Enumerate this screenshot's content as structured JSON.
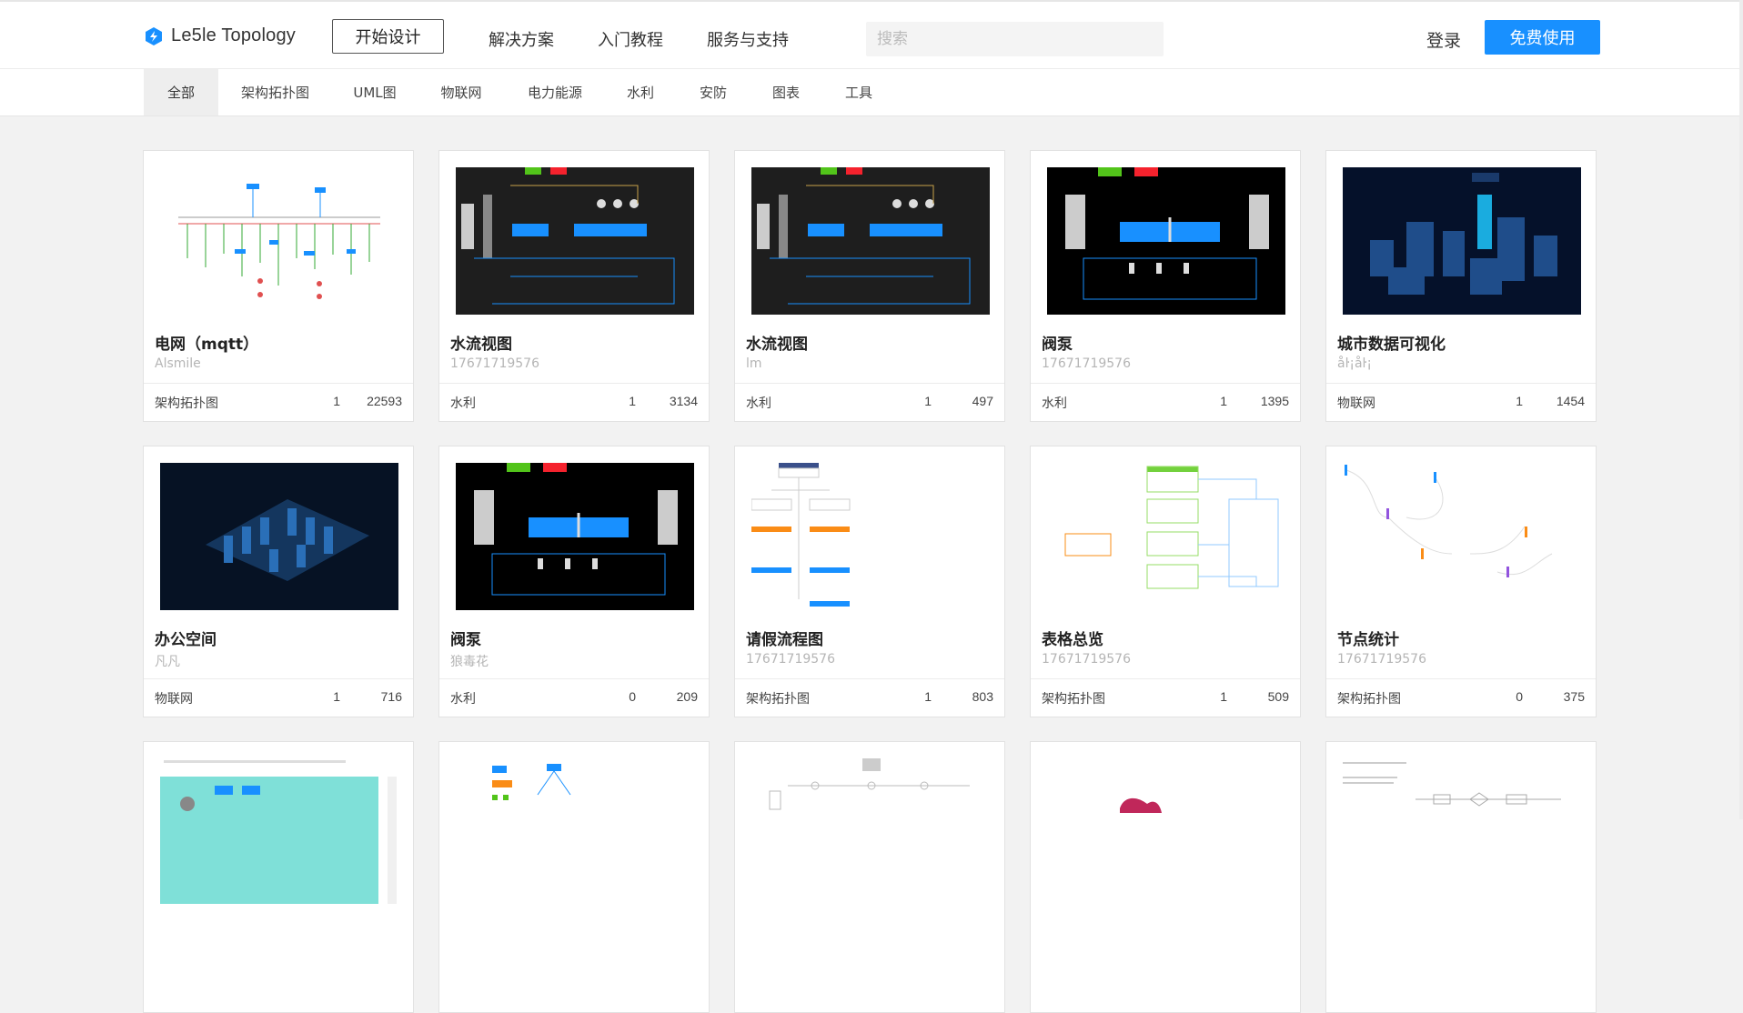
{
  "header": {
    "logo_text": "Le5le Topology",
    "start_design": "开始设计",
    "nav": [
      "解决方案",
      "入门教程",
      "服务与支持"
    ],
    "search_placeholder": "搜索",
    "login": "登录",
    "free_use": "免费使用",
    "accent_color": "#1890ff"
  },
  "categories": [
    "全部",
    "架构拓扑图",
    "UML图",
    "物联网",
    "电力能源",
    "水利",
    "安防",
    "图表",
    "工具"
  ],
  "active_category": "全部",
  "cards": [
    {
      "title": "电网（mqtt）",
      "author": "Alsmile",
      "category": "架构拓扑图",
      "likes": "1",
      "views": "22593",
      "thumb": "power-grid-diagram"
    },
    {
      "title": "水流视图",
      "author": "17671719576",
      "category": "水利",
      "likes": "1",
      "views": "3134",
      "thumb": "water-flow-dark"
    },
    {
      "title": "水流视图",
      "author": "lm",
      "category": "水利",
      "likes": "1",
      "views": "497",
      "thumb": "water-flow-dark"
    },
    {
      "title": "阀泵",
      "author": "17671719576",
      "category": "水利",
      "likes": "1",
      "views": "1395",
      "thumb": "valve-pump-dark"
    },
    {
      "title": "城市数据可视化",
      "author": "åŀ¡åŀ¡",
      "category": "物联网",
      "likes": "1",
      "views": "1454",
      "thumb": "city-3d-blue"
    },
    {
      "title": "办公空间",
      "author": "凡凡",
      "category": "物联网",
      "likes": "1",
      "views": "716",
      "thumb": "office-3d-blue"
    },
    {
      "title": "阀泵",
      "author": "狼毒花",
      "category": "水利",
      "likes": "0",
      "views": "209",
      "thumb": "valve-pump-dark"
    },
    {
      "title": "请假流程图",
      "author": "17671719576",
      "category": "架构拓扑图",
      "likes": "1",
      "views": "803",
      "thumb": "leave-flowchart"
    },
    {
      "title": "表格总览",
      "author": "17671719576",
      "category": "架构拓扑图",
      "likes": "1",
      "views": "509",
      "thumb": "table-overview"
    },
    {
      "title": "节点统计",
      "author": "17671719576",
      "category": "架构拓扑图",
      "likes": "0",
      "views": "375",
      "thumb": "node-stats"
    },
    {
      "title": "",
      "author": "",
      "category": "",
      "likes": "",
      "views": "",
      "thumb": "teal-panel"
    },
    {
      "title": "",
      "author": "",
      "category": "",
      "likes": "",
      "views": "",
      "thumb": "network-topology"
    },
    {
      "title": "",
      "author": "",
      "category": "",
      "likes": "",
      "views": "",
      "thumb": "process-diagram"
    },
    {
      "title": "",
      "author": "",
      "category": "",
      "likes": "",
      "views": "",
      "thumb": "red-shape"
    },
    {
      "title": "",
      "author": "",
      "category": "",
      "likes": "",
      "views": "",
      "thumb": "flowchart-light"
    }
  ]
}
